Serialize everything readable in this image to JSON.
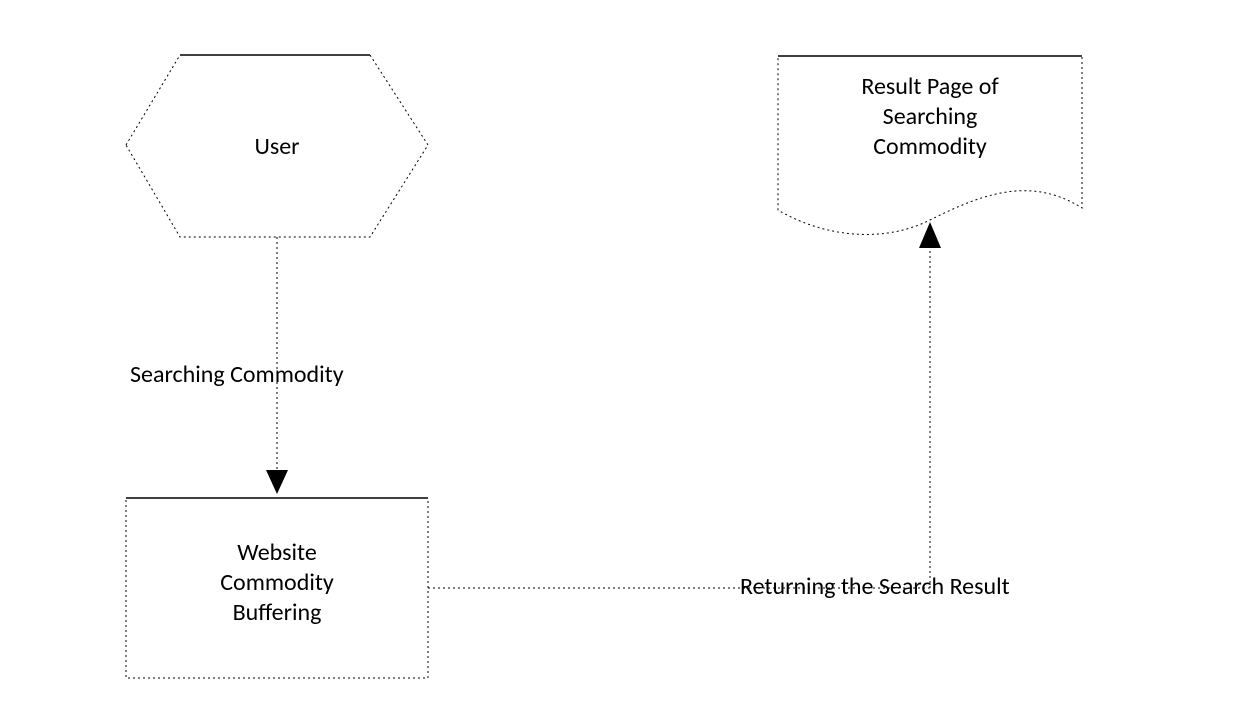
{
  "nodes": {
    "user": {
      "label": "User"
    },
    "buffer": {
      "label": "Website\nCommodity\nBuffering"
    },
    "result": {
      "label": "Result Page of\nSearching\nCommodity"
    }
  },
  "edges": {
    "userToBuffer": {
      "label": "Searching Commodity"
    },
    "bufferToResult": {
      "label": "Returning the Search Result"
    }
  }
}
